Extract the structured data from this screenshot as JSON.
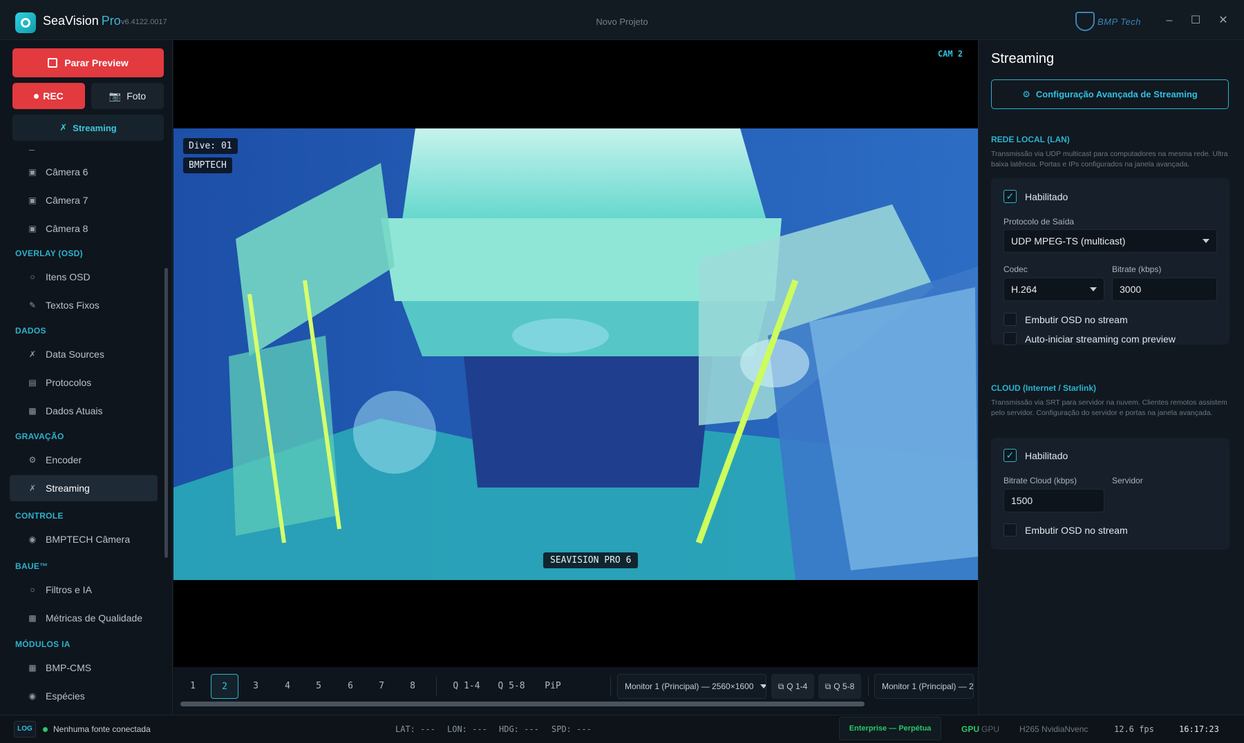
{
  "titlebar": {
    "app_name": "SeaVision",
    "app_edition": "Pro",
    "version": "v6.4122.0017",
    "project": "Novo Projeto",
    "brand": "BMP Tech",
    "minimize": "–",
    "maximize": "☐",
    "close": "✕"
  },
  "sidebar": {
    "stop_preview": "Parar Preview",
    "rec": "REC",
    "foto": "Foto",
    "streaming_top": "Streaming",
    "dash": "–",
    "cameras": [
      "Câmera 6",
      "Câmera 7",
      "Câmera 8"
    ],
    "sections": {
      "overlay": "OVERLAY (OSD)",
      "dados": "DADOS",
      "gravacao": "GRAVAÇÃO",
      "controle": "CONTROLE",
      "baue": "BAUE™",
      "modulos": "MÓDULOS IA"
    },
    "overlay_items": [
      "Itens OSD",
      "Textos Fixos"
    ],
    "dados_items": [
      "Data Sources",
      "Protocolos",
      "Dados Atuais"
    ],
    "gravacao_items": [
      "Encoder",
      "Streaming"
    ],
    "controle_items": [
      "BMPTECH Câmera"
    ],
    "baue_items": [
      "Filtros e IA",
      "Métricas de Qualidade"
    ],
    "modulos_items": [
      "BMP-CMS",
      "Espécies"
    ]
  },
  "video": {
    "cam_label": "CAM 2",
    "dive": "Dive: 01",
    "company": "BMPTECH",
    "footer": "SEAVISION PRO 6"
  },
  "controls": {
    "pages": [
      "1",
      "2",
      "3",
      "4",
      "5",
      "6",
      "7",
      "8"
    ],
    "active_page": "2",
    "quads": [
      "Q 1-4",
      "Q 5-8",
      "PiP"
    ],
    "monitor_main": "Monitor 1 (Principal) — 2560×1600",
    "q14_btn": "Q 1-4",
    "q58_btn": "Q 5-8",
    "monitor_second": "Monitor 1 (Principal) — 2"
  },
  "panel": {
    "title": "Streaming",
    "adv_button": "Configuração Avançada de Streaming",
    "lan": {
      "title": "REDE LOCAL (LAN)",
      "desc": "Transmissão via UDP multicast para computadores na mesma rede. Ultra baixa latência. Portas e IPs configurados na janela avançada.",
      "enabled_label": "Habilitado",
      "enabled": true,
      "protocol_label": "Protocolo de Saída",
      "protocol": "UDP MPEG-TS (multicast)",
      "codec_label": "Codec",
      "codec": "H.264",
      "bitrate_label": "Bitrate (kbps)",
      "bitrate": "3000",
      "embed_osd": "Embutir OSD no stream",
      "auto_start": "Auto-iniciar streaming com preview"
    },
    "cloud": {
      "title": "CLOUD (Internet / Starlink)",
      "desc": "Transmissão via SRT para servidor na nuvem. Clientes remotos assistem pelo servidor. Configuração do servidor e portas na janela avançada.",
      "enabled_label": "Habilitado",
      "enabled": true,
      "bitrate_label": "Bitrate Cloud (kbps)",
      "bitrate": "1500",
      "server_label": "Servidor",
      "embed_osd": "Embutir OSD no stream"
    }
  },
  "status": {
    "log": "LOG",
    "source": "Nenhuma fonte conectada",
    "lat": "LAT: ---",
    "lon": "LON: ---",
    "hdg": "HDG: ---",
    "spd": "SPD: ---",
    "license": "Enterprise — Perpétua",
    "gpu_label": "GPU",
    "gpu_value": "GPU",
    "encoder": "H265 NvidiaNvenc",
    "fps": "12.6 fps",
    "clock": "16:17:23"
  },
  "colors": {
    "accent": "#2bb3cf",
    "record": "#e23a3f",
    "ok": "#2cc76b"
  }
}
